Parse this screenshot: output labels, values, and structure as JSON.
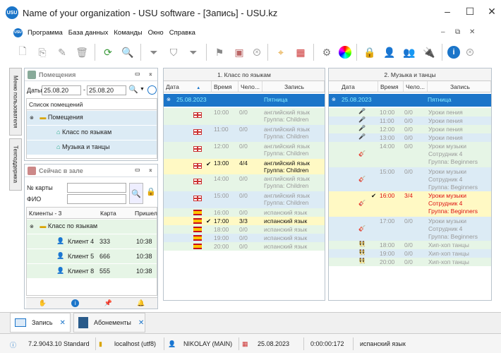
{
  "window": {
    "title": "Name of your organization - USU software - [Запись] - USU.kz",
    "logo": "USU"
  },
  "menu": [
    "Программа",
    "База данных",
    "Команды",
    "Окно",
    "Справка"
  ],
  "toolbar_icons": [
    "new-icon",
    "copy-icon",
    "edit-icon",
    "delete-icon",
    "refresh-icon",
    "search-icon",
    "filter-icon",
    "filter-add-icon",
    "filter-clear-icon",
    "flag-icon",
    "image-icon",
    "close-icon",
    "map-pin-icon",
    "calendar-icon",
    "settings-icon",
    "color-wheel-icon",
    "lock-icon",
    "user-icon",
    "users-icon",
    "plug-icon",
    "info-icon",
    "close-icon"
  ],
  "vtabs": [
    "Меню пользователя",
    "Техподдержка"
  ],
  "rooms_panel": {
    "title": "Помещения",
    "date_label": "Даты",
    "date_from": "25.08.20",
    "date_to": "25.08.20",
    "list_header": "Список помещений",
    "group": "Помещения",
    "items": [
      "Класс по языкам",
      "Музыка и танцы"
    ]
  },
  "hall_panel": {
    "title": "Сейчас в зале",
    "card_label": "№ карты",
    "name_label": "ФИО",
    "col_clients": "Клиенты - 3",
    "col_card": "Карта",
    "col_came": "Пришел",
    "group": "Класс по языкам",
    "clients": [
      {
        "name": "Клиент 4",
        "card": "333",
        "time": "10:38"
      },
      {
        "name": "Клиент 5",
        "card": "666",
        "time": "10:38"
      },
      {
        "name": "Клиент 8",
        "card": "555",
        "time": "10:38"
      }
    ]
  },
  "schedule1": {
    "title": "1. Класс по языкам",
    "cols": [
      "Дата",
      "Время",
      "Чело...",
      "Запись"
    ],
    "day_date": "25.08.2023",
    "day_name": "Пятница",
    "rows": [
      {
        "flag": "en",
        "time": "10:00",
        "count": "0/0",
        "l1": "английский язык",
        "l2": "Группа: Children",
        "check": "",
        "hl": false
      },
      {
        "flag": "en",
        "time": "11:00",
        "count": "0/0",
        "l1": "английский язык",
        "l2": "Группа: Children",
        "check": "",
        "hl": false
      },
      {
        "flag": "en",
        "time": "12:00",
        "count": "0/0",
        "l1": "английский язык",
        "l2": "Группа: Children",
        "check": "",
        "hl": false
      },
      {
        "flag": "en",
        "time": "13:00",
        "count": "4/4",
        "l1": "английский язык",
        "l2": "Группа: Children",
        "check": "✔",
        "hl": true
      },
      {
        "flag": "en",
        "time": "14:00",
        "count": "0/0",
        "l1": "английский язык",
        "l2": "Группа: Children",
        "check": "",
        "hl": false
      },
      {
        "flag": "en",
        "time": "15:00",
        "count": "0/0",
        "l1": "английский язык",
        "l2": "Группа: Children",
        "check": "",
        "hl": false
      },
      {
        "flag": "es",
        "time": "16:00",
        "count": "0/0",
        "l1": "испанский язык",
        "l2": "",
        "check": "",
        "hl": false
      },
      {
        "flag": "es",
        "time": "17:00",
        "count": "3/3",
        "l1": "испанский язык",
        "l2": "",
        "check": "✔",
        "hl": true
      },
      {
        "flag": "es",
        "time": "18:00",
        "count": "0/0",
        "l1": "испанский язык",
        "l2": "",
        "check": "",
        "hl": false
      },
      {
        "flag": "es",
        "time": "19:00",
        "count": "0/0",
        "l1": "испанский язык",
        "l2": "",
        "check": "",
        "hl": false
      },
      {
        "flag": "es",
        "time": "20:00",
        "count": "0/0",
        "l1": "испанский язык",
        "l2": "",
        "check": "",
        "hl": false
      }
    ]
  },
  "schedule2": {
    "title": "2. Музыка и танцы",
    "cols": [
      "Дата",
      "Время",
      "Чело...",
      "Запись"
    ],
    "day_date": "25.08.2023",
    "day_name": "Пятница",
    "rows": [
      {
        "icon": "mic",
        "time": "10:00",
        "count": "0/0",
        "l1": "Уроки пения",
        "l2": "",
        "l3": "",
        "check": "",
        "hl": false
      },
      {
        "icon": "mic",
        "time": "11:00",
        "count": "0/0",
        "l1": "Уроки пения",
        "l2": "",
        "l3": "",
        "check": "",
        "hl": false
      },
      {
        "icon": "mic",
        "time": "12:00",
        "count": "0/0",
        "l1": "Уроки пения",
        "l2": "",
        "l3": "",
        "check": "",
        "hl": false
      },
      {
        "icon": "mic",
        "time": "13:00",
        "count": "0/0",
        "l1": "Уроки пения",
        "l2": "",
        "l3": "",
        "check": "",
        "hl": false
      },
      {
        "icon": "guitar",
        "time": "14:00",
        "count": "0/0",
        "l1": "Уроки музыки",
        "l2": "Сотрудник 4",
        "l3": "Группа: Beginners",
        "check": "",
        "hl": false
      },
      {
        "icon": "guitar",
        "time": "15:00",
        "count": "0/0",
        "l1": "Уроки музыки",
        "l2": "Сотрудник 4",
        "l3": "Группа: Beginners",
        "check": "",
        "hl": false
      },
      {
        "icon": "guitar",
        "time": "16:00",
        "count": "3/4",
        "l1": "Уроки музыки",
        "l2": "Сотрудник 4",
        "l3": "Группа: Beginners",
        "check": "✔",
        "hl": true
      },
      {
        "icon": "guitar",
        "time": "17:00",
        "count": "0/0",
        "l1": "Уроки музыки",
        "l2": "Сотрудник 4",
        "l3": "Группа: Beginners",
        "check": "",
        "hl": false
      },
      {
        "icon": "dance",
        "time": "18:00",
        "count": "0/0",
        "l1": "Хип-хоп танцы",
        "l2": "",
        "l3": "",
        "check": "",
        "hl": false
      },
      {
        "icon": "dance",
        "time": "19:00",
        "count": "0/0",
        "l1": "Хип-хоп танцы",
        "l2": "",
        "l3": "",
        "check": "",
        "hl": false
      },
      {
        "icon": "dance",
        "time": "20:00",
        "count": "0/0",
        "l1": "Хип-хоп танцы",
        "l2": "",
        "l3": "",
        "check": "",
        "hl": false
      }
    ]
  },
  "bottom_tabs": [
    {
      "label": "Запись"
    },
    {
      "label": "Абонементы"
    }
  ],
  "status": {
    "version": "7.2.9043.10 Standard",
    "db": "localhost (utf8)",
    "user": "NIKOLAY (MAIN)",
    "date": "25.08.2023",
    "timer": "0:00:00:172",
    "current": "испанский язык"
  },
  "colors": {
    "accent": "#1b75c9",
    "highlight": "#fff9c4",
    "green_row": "#e6f5e6",
    "blue_row": "#dcebf5"
  }
}
